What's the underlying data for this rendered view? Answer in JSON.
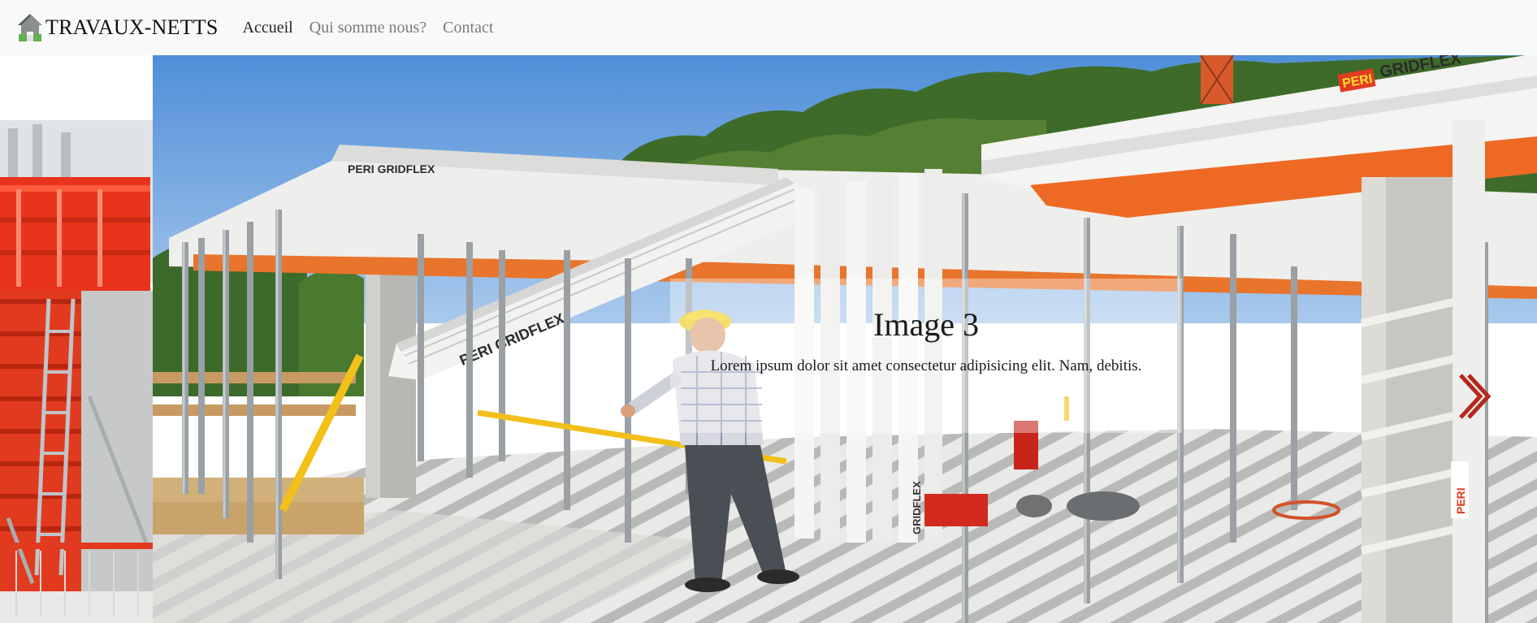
{
  "navbar": {
    "brand": "TRAVAUX-NETTS",
    "links": [
      {
        "label": "Accueil",
        "active": true
      },
      {
        "label": "Qui somme nous?",
        "active": false
      },
      {
        "label": "Contact",
        "active": false
      }
    ]
  },
  "carousel": {
    "active_slide": {
      "title": "Image 3",
      "text": "Lorem ipsum dolor sit amet consectetur adipisicing elit. Nam, debitis."
    },
    "photo_labels": {
      "beam_top_left": "PERI GRIDFLEX",
      "beam_top_right_brand": "PERI",
      "beam_top_right_model": "GRIDFLEX",
      "beam_diagonal": "PERI GRIDFLEX",
      "post_label": "GRIDFLEX",
      "post_label_right": "PERI"
    },
    "controls": {
      "next_icon": "chevron-right-icon",
      "next_color": "#c0392b"
    }
  }
}
